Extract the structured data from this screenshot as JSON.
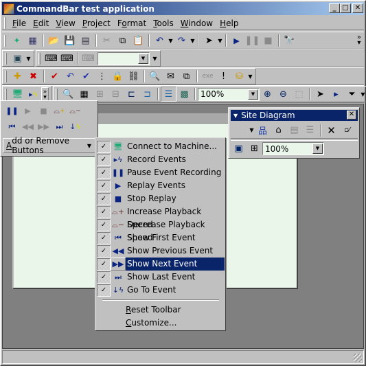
{
  "window": {
    "title": "CommandBar test application",
    "controls": {
      "minimize": "_",
      "maximize": "□",
      "close": "✕"
    }
  },
  "menubar": {
    "items": [
      {
        "label": "File",
        "accel": "F",
        "rest": "ile"
      },
      {
        "label": "Edit",
        "accel": "E",
        "rest": "dit"
      },
      {
        "label": "View",
        "accel": "V",
        "rest": "iew"
      },
      {
        "label": "Project",
        "accel": "P",
        "rest": "roject"
      },
      {
        "label": "Format",
        "pre": "F",
        "accel": "o",
        "rest": "rmat"
      },
      {
        "label": "Tools",
        "accel": "T",
        "rest": "ools"
      },
      {
        "label": "Window",
        "accel": "W",
        "rest": "indow"
      },
      {
        "label": "Help",
        "accel": "H",
        "rest": "elp"
      }
    ]
  },
  "toolbars": {
    "standard": {
      "icons": [
        "new-project-icon",
        "new-item-icon",
        "open-icon",
        "save-icon",
        "save-all-icon",
        "cut-icon",
        "copy-icon",
        "paste-icon",
        "undo-icon",
        "redo-icon",
        "pointer-timer-icon",
        "play-icon",
        "pause-icon",
        "stop-icon",
        "find-icon"
      ],
      "overflow": "»"
    },
    "row2": {
      "zoom_combo_value": ""
    },
    "row4": {
      "zoom_value": "100%"
    }
  },
  "palette": {
    "row1": [
      "pause",
      "replay",
      "stop",
      "increase-speed",
      "decrease-speed"
    ],
    "row2": [
      "first",
      "previous",
      "next",
      "last",
      "goto"
    ],
    "add_remove_label": "Add or Remove Buttons",
    "add_remove_accel": "A",
    "add_remove_rest": "dd or Remove Buttons"
  },
  "menu": {
    "items": [
      {
        "label": "Connect to Machine...",
        "checked": true,
        "icon": "connect-machine-icon",
        "glyph": "🖥"
      },
      {
        "label": "Record Events",
        "checked": true,
        "icon": "record-events-icon",
        "glyph": "▸ϟ"
      },
      {
        "label": "Pause Event Recording",
        "checked": true,
        "icon": "pause-icon",
        "glyph": "❚❚"
      },
      {
        "label": "Replay Events",
        "checked": true,
        "icon": "replay-icon",
        "glyph": "▶"
      },
      {
        "label": "Stop Replay",
        "checked": true,
        "icon": "stop-icon",
        "glyph": "■"
      },
      {
        "label": "Increase Playback Speed",
        "checked": true,
        "icon": "increase-speed-icon",
        "glyph": "⌓+"
      },
      {
        "label": "Decrease Playback Speed",
        "checked": true,
        "icon": "decrease-speed-icon",
        "glyph": "⌓−"
      },
      {
        "label": "Show First Event",
        "checked": true,
        "icon": "first-event-icon",
        "glyph": "⏮"
      },
      {
        "label": "Show Previous Event",
        "checked": true,
        "icon": "previous-event-icon",
        "glyph": "◀◀"
      },
      {
        "label": "Show Next Event",
        "checked": true,
        "icon": "next-event-icon",
        "glyph": "▶▶",
        "selected": true
      },
      {
        "label": "Show Last Event",
        "checked": true,
        "icon": "last-event-icon",
        "glyph": "⏭"
      },
      {
        "label": "Go To Event",
        "checked": true,
        "icon": "goto-event-icon",
        "glyph": "↓ϟ"
      }
    ],
    "reset": {
      "accel": "R",
      "rest": "eset Toolbar"
    },
    "customize": {
      "accel": "C",
      "rest": "ustomize..."
    }
  },
  "site_diagram": {
    "title": "Site Diagram",
    "zoom_value": "100%"
  }
}
